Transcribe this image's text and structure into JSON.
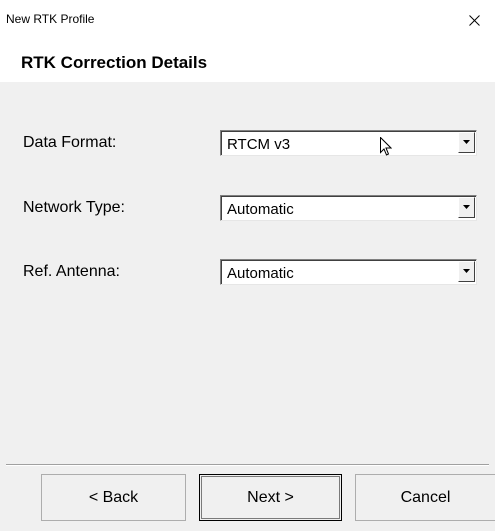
{
  "window": {
    "title": "New RTK Profile"
  },
  "header": {
    "title": "RTK Correction Details"
  },
  "form": {
    "data_format": {
      "label": "Data Format:",
      "value": "RTCM v3"
    },
    "network_type": {
      "label": "Network Type:",
      "value": "Automatic"
    },
    "ref_antenna": {
      "label": "Ref. Antenna:",
      "value": "Automatic"
    }
  },
  "buttons": {
    "back": "< Back",
    "next": "Next >",
    "cancel": "Cancel"
  },
  "icons": {
    "close": "close-icon",
    "dropdown": "chevron-down-icon",
    "cursor": "mouse-cursor-icon"
  }
}
